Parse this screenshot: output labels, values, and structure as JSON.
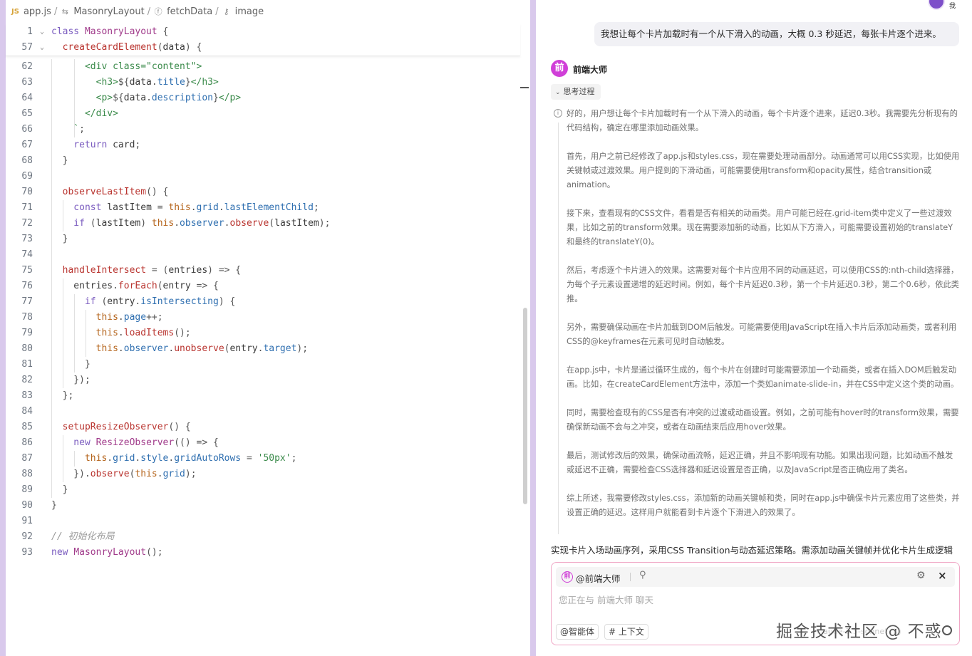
{
  "breadcrumb": {
    "file_badge": "JS",
    "items": [
      {
        "label": "app.js",
        "icon": "js-file-icon"
      },
      {
        "label": "MasonryLayout",
        "icon": "class-icon"
      },
      {
        "label": "fetchData",
        "icon": "function-icon"
      },
      {
        "label": "image",
        "icon": "key-icon"
      }
    ]
  },
  "editor": {
    "sticky": [
      {
        "ln": "1",
        "fold": "⌄",
        "tokens": [
          [
            "kw",
            "class "
          ],
          [
            "cl",
            "MasonryLayout"
          ],
          [
            "pun",
            " {"
          ]
        ]
      },
      {
        "ln": "57",
        "fold": "⌄",
        "tokens": [
          [
            "fn",
            "  createCardElement"
          ],
          [
            "pun",
            "("
          ],
          [
            "id",
            "data"
          ],
          [
            "pun",
            ") {"
          ]
        ]
      }
    ],
    "lines": [
      {
        "ln": "62",
        "g": [
          64,
          96
        ],
        "tokens": [
          [
            "str",
            "      <div class=\"content\">"
          ]
        ]
      },
      {
        "ln": "63",
        "g": [
          64,
          96
        ],
        "tokens": [
          [
            "str",
            "        <h3>"
          ],
          [
            "pun",
            "${"
          ],
          [
            "id",
            "data"
          ],
          [
            "pun",
            "."
          ],
          [
            "prop",
            "title"
          ],
          [
            "pun",
            "}"
          ],
          [
            "str",
            "</h3>"
          ]
        ]
      },
      {
        "ln": "64",
        "g": [
          64,
          96
        ],
        "tokens": [
          [
            "str",
            "        <p>"
          ],
          [
            "pun",
            "${"
          ],
          [
            "id",
            "data"
          ],
          [
            "pun",
            "."
          ],
          [
            "prop",
            "description"
          ],
          [
            "pun",
            "}"
          ],
          [
            "str",
            "</p>"
          ]
        ]
      },
      {
        "ln": "65",
        "g": [
          64,
          96
        ],
        "tokens": [
          [
            "str",
            "      </div>"
          ]
        ]
      },
      {
        "ln": "66",
        "g": [
          64,
          96
        ],
        "tokens": [
          [
            "str",
            "    `"
          ],
          [
            "pun",
            ";"
          ]
        ]
      },
      {
        "ln": "67",
        "g": [
          64
        ],
        "tokens": [
          [
            "kw",
            "    return "
          ],
          [
            "id",
            "card"
          ],
          [
            "pun",
            ";"
          ]
        ]
      },
      {
        "ln": "68",
        "g": [
          64
        ],
        "tokens": [
          [
            "pun",
            "  }"
          ]
        ]
      },
      {
        "ln": "69",
        "g": [
          64
        ],
        "tokens": [
          [
            "id",
            ""
          ]
        ]
      },
      {
        "ln": "70",
        "g": [
          64
        ],
        "tokens": [
          [
            "fn",
            "  observeLastItem"
          ],
          [
            "pun",
            "() {"
          ]
        ]
      },
      {
        "ln": "71",
        "g": [
          64,
          80
        ],
        "tokens": [
          [
            "kw",
            "    const "
          ],
          [
            "id",
            "lastItem "
          ],
          [
            "pun",
            "= "
          ],
          [
            "this",
            "this"
          ],
          [
            "pun",
            "."
          ],
          [
            "prop",
            "grid"
          ],
          [
            "pun",
            "."
          ],
          [
            "prop",
            "lastElementChild"
          ],
          [
            "pun",
            ";"
          ]
        ]
      },
      {
        "ln": "72",
        "g": [
          64,
          80
        ],
        "tokens": [
          [
            "kw",
            "    if "
          ],
          [
            "pun",
            "("
          ],
          [
            "id",
            "lastItem"
          ],
          [
            "pun",
            ") "
          ],
          [
            "this",
            "this"
          ],
          [
            "pun",
            "."
          ],
          [
            "prop",
            "observer"
          ],
          [
            "pun",
            "."
          ],
          [
            "fn",
            "observe"
          ],
          [
            "pun",
            "("
          ],
          [
            "id",
            "lastItem"
          ],
          [
            "pun",
            ");"
          ]
        ]
      },
      {
        "ln": "73",
        "g": [
          64
        ],
        "tokens": [
          [
            "pun",
            "  }"
          ]
        ]
      },
      {
        "ln": "74",
        "g": [
          64
        ],
        "tokens": [
          [
            "id",
            ""
          ]
        ]
      },
      {
        "ln": "75",
        "g": [
          64
        ],
        "tokens": [
          [
            "fn",
            "  handleIntersect "
          ],
          [
            "pun",
            "= ("
          ],
          [
            "id",
            "entries"
          ],
          [
            "pun",
            ") => {"
          ]
        ]
      },
      {
        "ln": "76",
        "g": [
          64,
          80
        ],
        "tokens": [
          [
            "id",
            "    entries"
          ],
          [
            "pun",
            "."
          ],
          [
            "fn",
            "forEach"
          ],
          [
            "pun",
            "("
          ],
          [
            "id",
            "entry "
          ],
          [
            "pun",
            "=> {"
          ]
        ]
      },
      {
        "ln": "77",
        "g": [
          64,
          80,
          96
        ],
        "tokens": [
          [
            "kw",
            "      if "
          ],
          [
            "pun",
            "("
          ],
          [
            "id",
            "entry"
          ],
          [
            "pun",
            "."
          ],
          [
            "prop",
            "isIntersecting"
          ],
          [
            "pun",
            ") {"
          ]
        ]
      },
      {
        "ln": "78",
        "g": [
          64,
          80,
          96,
          112
        ],
        "tokens": [
          [
            "this",
            "        this"
          ],
          [
            "pun",
            "."
          ],
          [
            "prop",
            "page"
          ],
          [
            "pun",
            "++;"
          ]
        ]
      },
      {
        "ln": "79",
        "g": [
          64,
          80,
          96,
          112
        ],
        "tokens": [
          [
            "this",
            "        this"
          ],
          [
            "pun",
            "."
          ],
          [
            "fn",
            "loadItems"
          ],
          [
            "pun",
            "();"
          ]
        ]
      },
      {
        "ln": "80",
        "g": [
          64,
          80,
          96,
          112
        ],
        "tokens": [
          [
            "this",
            "        this"
          ],
          [
            "pun",
            "."
          ],
          [
            "prop",
            "observer"
          ],
          [
            "pun",
            "."
          ],
          [
            "fn",
            "unobserve"
          ],
          [
            "pun",
            "("
          ],
          [
            "id",
            "entry"
          ],
          [
            "pun",
            "."
          ],
          [
            "prop",
            "target"
          ],
          [
            "pun",
            ");"
          ]
        ]
      },
      {
        "ln": "81",
        "g": [
          64,
          80,
          96
        ],
        "tokens": [
          [
            "pun",
            "      }"
          ]
        ]
      },
      {
        "ln": "82",
        "g": [
          64,
          80
        ],
        "tokens": [
          [
            "pun",
            "    });"
          ]
        ]
      },
      {
        "ln": "83",
        "g": [
          64
        ],
        "tokens": [
          [
            "pun",
            "  };"
          ]
        ]
      },
      {
        "ln": "84",
        "g": [
          64
        ],
        "tokens": [
          [
            "id",
            ""
          ]
        ]
      },
      {
        "ln": "85",
        "g": [
          64
        ],
        "tokens": [
          [
            "fn",
            "  setupResizeObserver"
          ],
          [
            "pun",
            "() {"
          ]
        ]
      },
      {
        "ln": "86",
        "g": [
          64,
          80
        ],
        "tokens": [
          [
            "kw",
            "    new "
          ],
          [
            "cl",
            "ResizeObserver"
          ],
          [
            "pun",
            "(() => {"
          ]
        ]
      },
      {
        "ln": "87",
        "g": [
          64,
          80,
          96
        ],
        "tokens": [
          [
            "this",
            "      this"
          ],
          [
            "pun",
            "."
          ],
          [
            "prop",
            "grid"
          ],
          [
            "pun",
            "."
          ],
          [
            "prop",
            "style"
          ],
          [
            "pun",
            "."
          ],
          [
            "prop",
            "gridAutoRows "
          ],
          [
            "pun",
            "= "
          ],
          [
            "str",
            "'50px'"
          ],
          [
            "pun",
            ";"
          ]
        ]
      },
      {
        "ln": "88",
        "g": [
          64,
          80
        ],
        "tokens": [
          [
            "pun",
            "    })."
          ],
          [
            "fn",
            "observe"
          ],
          [
            "pun",
            "("
          ],
          [
            "this",
            "this"
          ],
          [
            "pun",
            "."
          ],
          [
            "prop",
            "grid"
          ],
          [
            "pun",
            ");"
          ]
        ]
      },
      {
        "ln": "89",
        "g": [
          64
        ],
        "tokens": [
          [
            "pun",
            "  }"
          ]
        ]
      },
      {
        "ln": "90",
        "g": [],
        "tokens": [
          [
            "pun",
            "}"
          ]
        ]
      },
      {
        "ln": "91",
        "g": [],
        "tokens": [
          [
            "id",
            ""
          ]
        ]
      },
      {
        "ln": "92",
        "g": [],
        "tokens": [
          [
            "cm",
            "// 初始化布局"
          ]
        ]
      },
      {
        "ln": "93",
        "g": [],
        "tokens": [
          [
            "kw",
            "new "
          ],
          [
            "cl",
            "MasonryLayout"
          ],
          [
            "pun",
            "();"
          ]
        ]
      }
    ]
  },
  "chat": {
    "user_name": "我",
    "user_message": "我想让每个卡片加载时有一个从下滑入的动画，大概 0.3 秒延迟，每张卡片逐个进来。",
    "bot_avatar_char": "前",
    "bot_name": "前端大师",
    "thinking_label": "思考过程",
    "thinking": [
      "好的，用户想让每个卡片加载时有一个从下滑入的动画，每个卡片逐个进来，延迟0.3秒。我需要先分析现有的代码结构，确定在哪里添加动画效果。",
      "首先，用户之前已经修改了app.js和styles.css，现在需要处理动画部分。动画通常可以用CSS实现，比如使用关键帧或过渡效果。用户提到的下滑动画，可能需要使用transform和opacity属性，结合transition或animation。",
      "接下来，查看现有的CSS文件，看看是否有相关的动画类。用户可能已经在.grid-item类中定义了一些过渡效果，比如之前的transform效果。现在需要添加新的动画，比如从下方滑入，可能需要设置初始的translateY和最终的translateY(0)。",
      "然后，考虑逐个卡片进入的效果。这需要对每个卡片应用不同的动画延迟，可以使用CSS的:nth-child选择器，为每个子元素设置递增的延迟时间。例如，每个卡片延迟0.3秒，第一个卡片延迟0.3秒，第二个0.6秒，依此类推。",
      "另外，需要确保动画在卡片加载到DOM后触发。可能需要使用JavaScript在插入卡片后添加动画类，或者利用CSS的@keyframes在元素可见时自动触发。",
      "在app.js中，卡片是通过循环生成的，每个卡片在创建时可能需要添加一个动画类，或者在插入DOM后触发动画。比如，在createCardElement方法中，添加一个类如animate-slide-in，并在CSS中定义这个类的动画。",
      "同时，需要检查现有的CSS是否有冲突的过渡或动画设置。例如，之前可能有hover时的transform效果，需要确保新动画不会与之冲突，或者在动画结束后应用hover效果。",
      "最后，测试修改后的效果，确保动画流畅，延迟正确，并且不影响现有功能。如果出现问题，比如动画不触发或延迟不正确，需要检查CSS选择器和延迟设置是否正确，以及JavaScript是否正确应用了类名。",
      "综上所述，我需要修改styles.css，添加新的动画关键帧和类，同时在app.js中确保卡片元素应用了这些类，并设置正确的延迟。这样用户就能看到卡片逐个下滑进入的效果了。"
    ],
    "answer_preview": "实现卡片入场动画序列，采用CSS Transition与动态延迟策略。需添加动画关键帧并优化卡片生成逻辑",
    "input": {
      "agent_icon_char": "前",
      "agent_label": "@前端大师",
      "placeholder": "您正在与 前端大师 聊天",
      "chip_agent": "@智能体",
      "chip_context": "# 上下文",
      "model_text": "claude-3.5-sonnet (K)"
    },
    "watermark": "掘金技术社区 @ 不惑"
  },
  "colors": {
    "accent": "#d03fd8",
    "frame": "#d9c9ec",
    "input_border": "#f0a7c6"
  }
}
